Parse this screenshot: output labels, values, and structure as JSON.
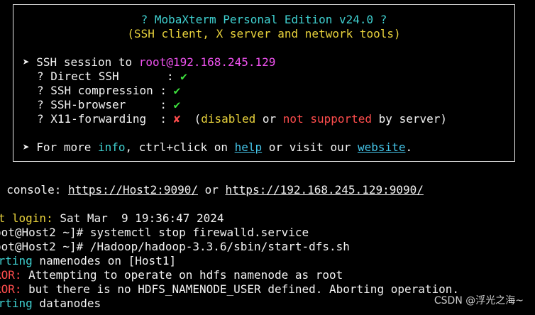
{
  "banner": {
    "title": "? MobaXterm Personal Edition v24.0 ?",
    "subtitle": "(SSH client, X server and network tools)",
    "session_arrow": "➤",
    "session_label": "SSH session to ",
    "session_target": "root@192.168.245.129",
    "features": [
      {
        "label": "? Direct SSH       : ",
        "mark": "✔",
        "status": "ok"
      },
      {
        "label": "? SSH compression : ",
        "mark": "✔",
        "status": "ok"
      },
      {
        "label": "? SSH-browser     : ",
        "mark": "✔",
        "status": "ok"
      },
      {
        "label": "? X11-forwarding  : ",
        "mark": "✘",
        "status": "fail"
      }
    ],
    "x11_note": {
      "open": "(",
      "disabled": "disabled",
      "or": " or ",
      "not_supported": "not supported",
      "tail": " by server)"
    },
    "more": {
      "arrow": "➤",
      "prefix": "For more ",
      "info": "info",
      "mid": ", ctrl+click on ",
      "help": "help",
      "visit": " or visit our ",
      "website": "website",
      "end": "."
    }
  },
  "console": {
    "prefix": "b console: ",
    "url1": "https://Host2:9090/",
    "or": " or ",
    "url2": "https://192.168.245.129:9090/"
  },
  "terminal_lines": [
    {
      "tag": "st login:",
      "text": " Sat Mar  9 19:36:47 2024",
      "tag_color": "yellow"
    },
    {
      "tag": "",
      "text": "oot@Host2 ~]# systemctl stop firewalld.service",
      "tag_color": ""
    },
    {
      "tag": "",
      "text": "oot@Host2 ~]# /Hadoop/hadoop-3.3.6/sbin/start-dfs.sh",
      "tag_color": ""
    },
    {
      "tag": "arting",
      "text": " namenodes on [Host1]",
      "tag_color": "cyan"
    },
    {
      "tag": "ROR:",
      "text": " Attempting to operate on hdfs namenode as root",
      "tag_color": "red"
    },
    {
      "tag": "ROR:",
      "text": " but there is no HDFS_NAMENODE_USER defined. Aborting operation.",
      "tag_color": "red"
    },
    {
      "tag": "arting",
      "text": " datanodes",
      "tag_color": "cyan"
    }
  ],
  "watermark": "CSDN @浮光之海~",
  "colors": {
    "background": "#000000",
    "foreground": "#f2f2f2",
    "cyan": "#3fd0d0",
    "yellow": "#e8d23c",
    "magenta": "#f052f0",
    "green": "#3ee33e",
    "red": "#ff4d4d",
    "link": "#45c6ea"
  }
}
